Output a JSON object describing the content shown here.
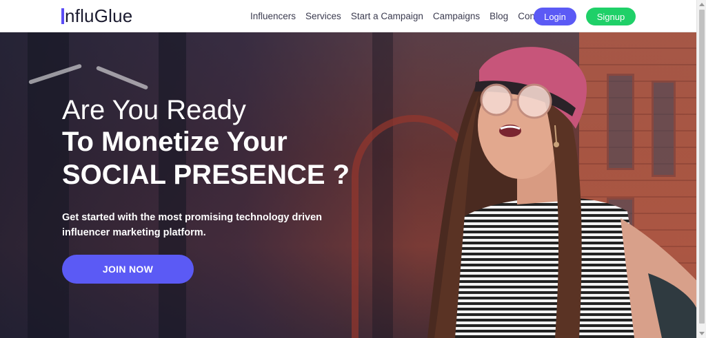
{
  "brand": {
    "logo_text": "nfluGlue",
    "logo_initial": "I"
  },
  "nav": {
    "items": [
      "Influencers",
      "Services",
      "Start a Campaign",
      "Campaigns",
      "Blog",
      "Contact"
    ],
    "login_label": "Login",
    "signup_label": "Signup"
  },
  "hero": {
    "line1": "Are You Ready",
    "line2": "To Monetize Your",
    "line3": "SOCIAL PRESENCE ?",
    "subtitle": "Get started with the most promising technology driven influencer marketing platform.",
    "cta_label": "JOIN NOW"
  },
  "colors": {
    "accent": "#5b5af5",
    "signup": "#1fd068",
    "hat": "#c7557a"
  }
}
